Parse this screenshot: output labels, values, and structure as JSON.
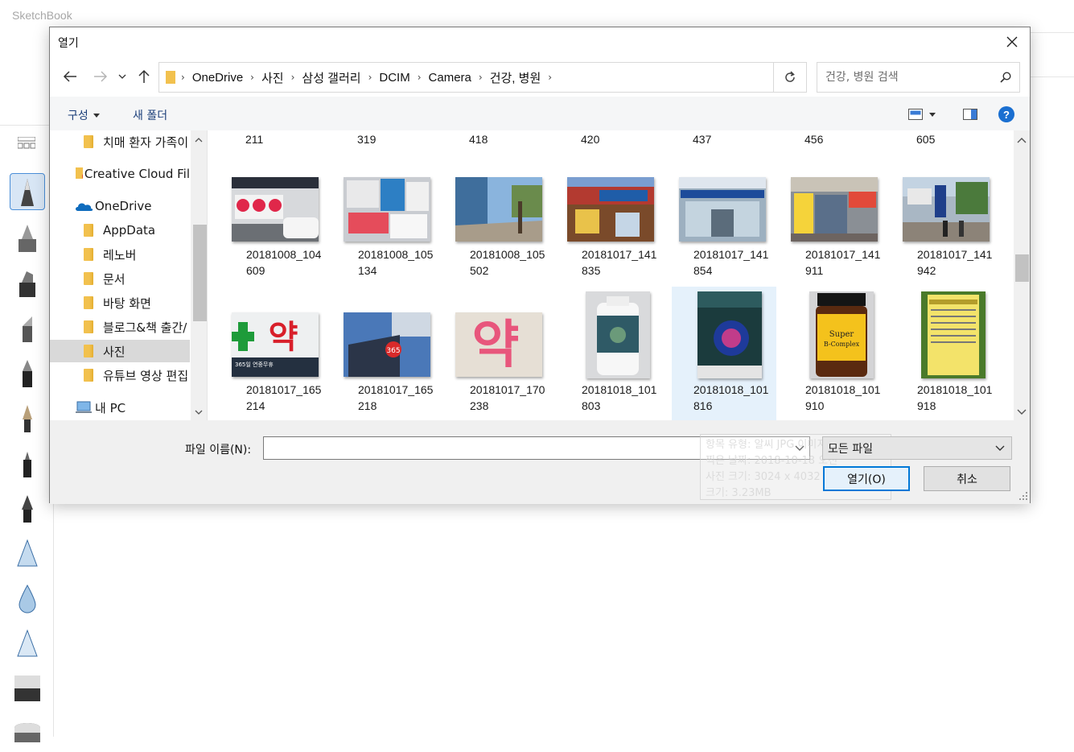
{
  "app": {
    "title": "SketchBook"
  },
  "dialog": {
    "title": "열기",
    "breadcrumbs": [
      "OneDrive",
      "사진",
      "삼성 갤러리",
      "DCIM",
      "Camera",
      "건강, 병원"
    ],
    "search_placeholder": "건강, 병원 검색",
    "commands": {
      "organize": "구성",
      "new_folder": "새 폴더"
    },
    "nav_items": [
      {
        "label": "치매 환자 가족이",
        "type": "folder"
      },
      {
        "label": "Creative Cloud Fil",
        "type": "cc"
      },
      {
        "label": "OneDrive",
        "type": "onedrive"
      },
      {
        "label": "AppData",
        "type": "folder"
      },
      {
        "label": "레노버",
        "type": "folder"
      },
      {
        "label": "문서",
        "type": "folder"
      },
      {
        "label": "바탕 화면",
        "type": "folder"
      },
      {
        "label": "블로그&책 출간/",
        "type": "folder"
      },
      {
        "label": "사진",
        "type": "folder",
        "selected": true
      },
      {
        "label": "유튜브 영상 편집",
        "type": "folder"
      },
      {
        "label": "내 PC",
        "type": "pc"
      }
    ],
    "top_row_labels": [
      "211",
      "319",
      "418",
      "420",
      "437",
      "456",
      "605"
    ],
    "files": [
      {
        "name": "20181008_104609",
        "l1": "20181008_104",
        "l2": "609",
        "theme": "storefront-sign"
      },
      {
        "name": "20181008_105134",
        "l1": "20181008_105",
        "l2": "134",
        "theme": "boxes"
      },
      {
        "name": "20181008_105502",
        "l1": "20181008_105",
        "l2": "502",
        "theme": "street"
      },
      {
        "name": "20181017_141835",
        "l1": "20181017_141",
        "l2": "835",
        "theme": "shop-red"
      },
      {
        "name": "20181017_141854",
        "l1": "20181017_141",
        "l2": "854",
        "theme": "shop-glass"
      },
      {
        "name": "20181017_141911",
        "l1": "20181017_141",
        "l2": "911",
        "theme": "shop-yellow"
      },
      {
        "name": "20181017_141942",
        "l1": "20181017_141",
        "l2": "942",
        "theme": "street-crowd"
      },
      {
        "name": "20181017_165214",
        "l1": "20181017_165",
        "l2": "214",
        "theme": "pharmacy-cross",
        "sign_text": "약",
        "sign_sub": "365일 연중무휴"
      },
      {
        "name": "20181017_165218",
        "l1": "20181017_165",
        "l2": "218",
        "theme": "tower-sign"
      },
      {
        "name": "20181017_170238",
        "l1": "20181017_170",
        "l2": "238",
        "theme": "pink-sign",
        "sign_text": "약"
      },
      {
        "name": "20181018_101803",
        "l1": "20181018_101",
        "l2": "803",
        "theme": "bottle-white"
      },
      {
        "name": "20181018_101816",
        "l1": "20181018_101",
        "l2": "816",
        "theme": "bottle-green",
        "selected": true
      },
      {
        "name": "20181018_101910",
        "l1": "20181018_101",
        "l2": "910",
        "theme": "bottle-brown",
        "sign_text": "Super B-Complex"
      },
      {
        "name": "20181018_101918",
        "l1": "20181018_101",
        "l2": "918",
        "theme": "bottle-label"
      }
    ],
    "filename_label": "파일 이름(N):",
    "filename_value": "",
    "filetype_value": "모든 파일",
    "open_label": "열기(O)",
    "cancel_label": "취소",
    "tooltip": [
      "항목 유형: 알씨 JPG 이미지",
      "찍은 날짜: 2018-10-18 오전",
      "사진 크기: 3024 x 4032",
      "크기: 3.23MB"
    ]
  }
}
